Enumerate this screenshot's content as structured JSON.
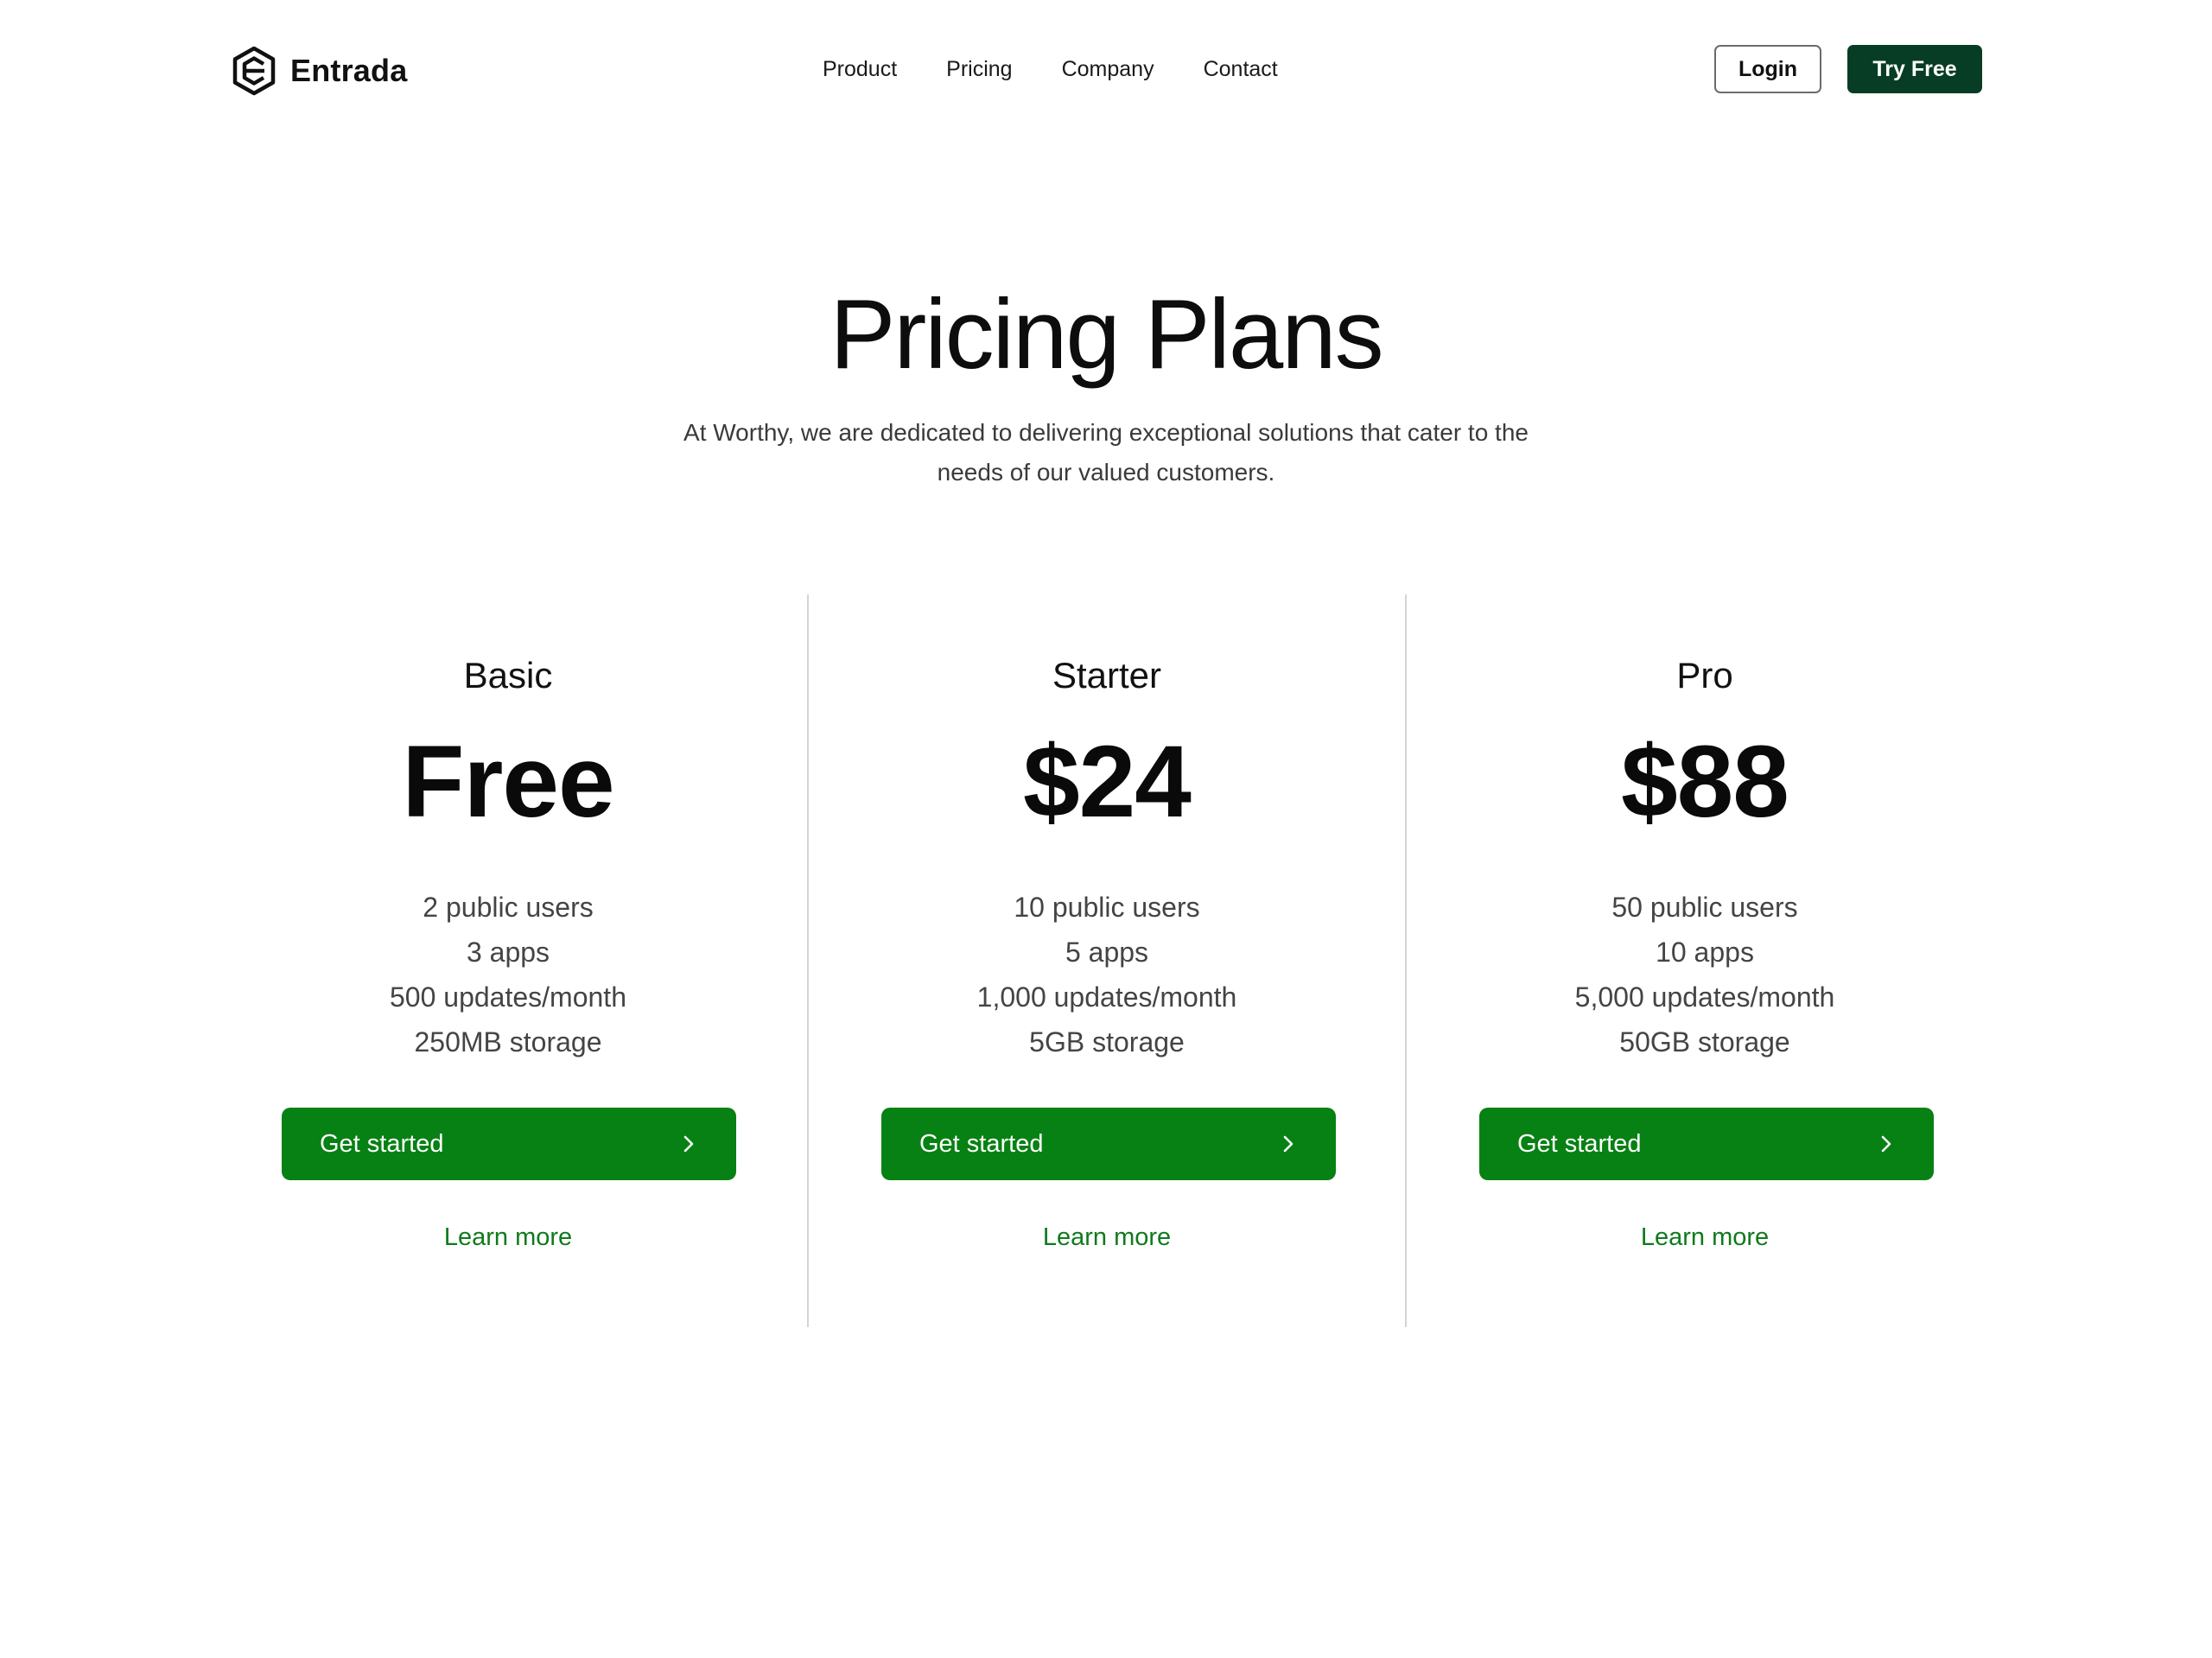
{
  "header": {
    "brand": "Entrada",
    "logo_icon": "hexagon-e-logo-icon",
    "nav": [
      "Product",
      "Pricing",
      "Company",
      "Contact"
    ],
    "login_label": "Login",
    "try_label": "Try Free"
  },
  "hero": {
    "title": "Pricing Plans",
    "subtitle": "At Worthy, we are dedicated to delivering exceptional solutions that cater to the needs of our valued customers."
  },
  "plans": [
    {
      "name": "Basic",
      "price": "Free",
      "features": [
        "2 public users",
        "3 apps",
        "500 updates/month",
        "250MB storage"
      ],
      "cta": "Get started",
      "link": "Learn more"
    },
    {
      "name": "Starter",
      "price": "$24",
      "features": [
        "10 public users",
        "5 apps",
        "1,000 updates/month",
        "5GB storage"
      ],
      "cta": "Get started",
      "link": "Learn more"
    },
    {
      "name": "Pro",
      "price": "$88",
      "features": [
        "50 public users",
        "10 apps",
        "5,000 updates/month",
        "50GB storage"
      ],
      "cta": "Get started",
      "link": "Learn more"
    }
  ],
  "colors": {
    "primary_green": "#078113",
    "dark_green": "#063d24",
    "link_green": "#0f7a1c",
    "divider": "#d4d4d4"
  },
  "icons": {
    "cta_icon": "chevron-right-icon"
  }
}
